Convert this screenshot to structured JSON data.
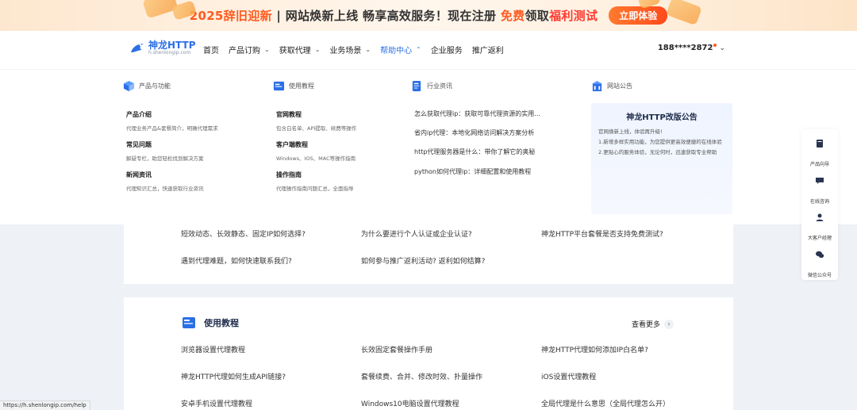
{
  "promo": {
    "year": "2025辞旧迎新",
    "text1": " | 网站焕新上线 畅享高效服务！现在注册 ",
    "free": "免费",
    "text2": "领取",
    "benefit": "福利测试",
    "cta": "立即体验"
  },
  "nav": {
    "logo_title": "神龙HTTP",
    "logo_sub": "h.shenlongip.com",
    "items": [
      {
        "label": "首页",
        "chevron": ""
      },
      {
        "label": "产品订购",
        "chevron": "⌄"
      },
      {
        "label": "获取代理",
        "chevron": "⌄"
      },
      {
        "label": "业务场景",
        "chevron": "⌄"
      },
      {
        "label": "帮助中心",
        "chevron": "⌃"
      },
      {
        "label": "企业服务",
        "chevron": ""
      },
      {
        "label": "推广返利",
        "chevron": ""
      }
    ],
    "phone": "188****2872"
  },
  "mega": {
    "col1": {
      "head": "产品与功能",
      "items": [
        {
          "title": "产品介绍",
          "desc": "代理业务产品&套餐简介，明确代理需求"
        },
        {
          "title": "常见问题",
          "desc": "解疑专栏，助您轻松找到解决方案"
        },
        {
          "title": "新闻资讯",
          "desc": "代理知识汇总，快速获取行业资讯"
        }
      ]
    },
    "col2": {
      "head": "使用教程",
      "items": [
        {
          "title": "官网教程",
          "desc": "包含白名单、API提取、续费等操作"
        },
        {
          "title": "客户端教程",
          "desc": "Windows、IOS、MAC等操作指南"
        },
        {
          "title": "操作指南",
          "desc": "代理操作指南问题汇总，全面指导"
        }
      ]
    },
    "col3": {
      "head": "行业资讯",
      "items": [
        "怎么获取代理ip：获取可靠代理资源的实用...",
        "省内ip代理：本地化网络访问解决方案分析",
        "http代理服务器是什么：带你了解它的奥秘",
        "python如何代理ip：详细配置和使用教程"
      ]
    },
    "col4": {
      "head": "网站公告",
      "notice_title": "神龙HTTP改版公告",
      "notice_lines": [
        "官网焕新上线，体验再升级!",
        "1.新增多样实用功能，为您提供更高效便捷的在线体验",
        "2.更贴心的服务体验，无论何时，迅速获取专业帮助"
      ]
    }
  },
  "faq": {
    "row1": [
      "短效动态、长效静态、固定IP如何选择?",
      "为什么要进行个人认证或企业认证?",
      "神龙HTTP平台套餐是否支持免费测试?"
    ],
    "row2": [
      "遇到代理难题，如何快速联系我们?",
      "如何参与推广返利活动? 返利如何结算?"
    ]
  },
  "tutorial": {
    "title": "使用教程",
    "more": "查看更多",
    "rows": [
      [
        "浏览器设置代理教程",
        "长效固定套餐操作手册",
        "神龙HTTP代理如何添加IP白名单?"
      ],
      [
        "神龙HTTP代理如何生成API链接?",
        "套餐续费、合并、修改时效、扑量操作",
        "iOS设置代理教程"
      ],
      [
        "安卓手机设置代理教程",
        "Windows10电脑设置代理教程",
        "全局代理是什么意思（全局代理怎么开）"
      ]
    ]
  },
  "floatbar": [
    "产品向导",
    "在线咨询",
    "大客户经理",
    "微信公众号"
  ],
  "status_url": "https://h.shenlongip.com/help",
  "colors": {
    "accent": "#2b6fe6",
    "promo_orange": "#ff5a1f"
  }
}
